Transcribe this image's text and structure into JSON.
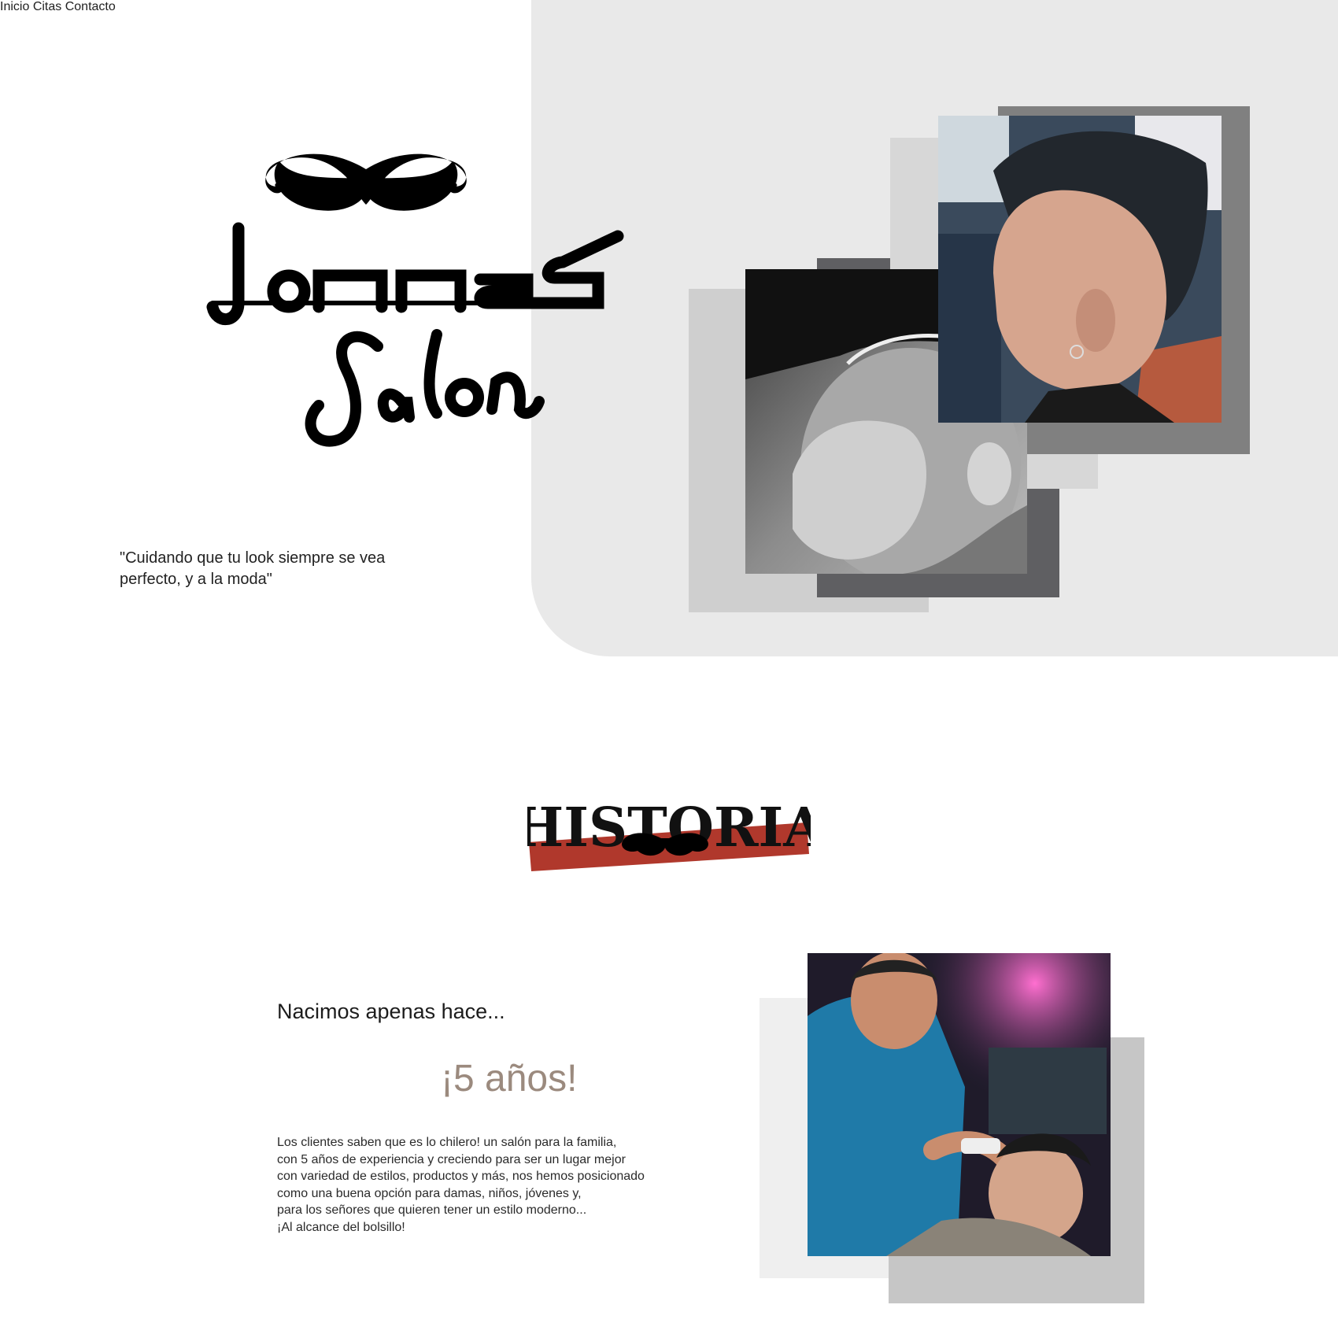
{
  "nav": {
    "items": [
      {
        "label": "Inicio"
      },
      {
        "label": "Citas"
      },
      {
        "label": "Contacto"
      }
    ]
  },
  "hero": {
    "logo_text_1": "Jonnas",
    "logo_text_2": "Salon",
    "tagline": "\"Cuidando que tu look siempre se vea perfecto, y a la moda\""
  },
  "history": {
    "title": "HISTORIA",
    "subheading": "Nacimos apenas hace...",
    "years": "¡5 años!",
    "paragraph_lines": [
      "Los clientes saben que es lo chilero! un salón para la familia,",
      "con 5 años de experiencia y creciendo para ser un lugar mejor",
      "con variedad de estilos, productos y más, nos hemos posicionado",
      "como una buena opción para damas, niños, jóvenes y,",
      "para los señores que quieren tener un estilo moderno...",
      "¡Al alcance del bolsillo!"
    ]
  },
  "colors": {
    "hero_background": "#e9e9e9",
    "accent_brown": "#9b8a7e",
    "brush_red": "#b0382c",
    "frame_dark": "#7f7f7f",
    "frame_mid": "#cfcfcf"
  }
}
